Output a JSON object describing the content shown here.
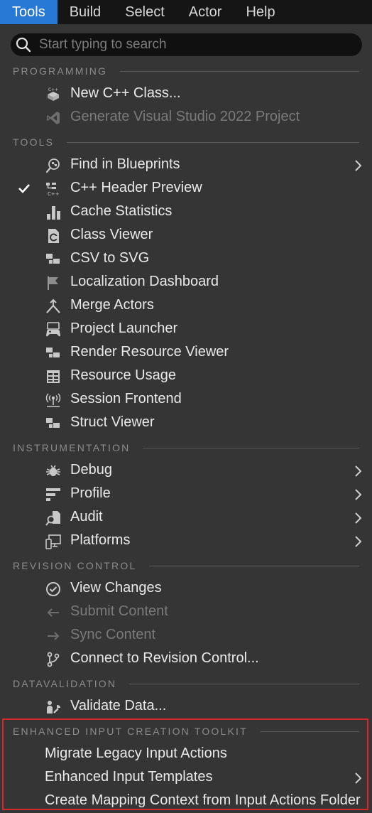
{
  "menubar": {
    "items": [
      "Tools",
      "Build",
      "Select",
      "Actor",
      "Help"
    ],
    "active": "Tools"
  },
  "search": {
    "placeholder": "Start typing to search",
    "icon": "search-icon"
  },
  "sections": {
    "programming": "PROGRAMMING",
    "tools": "TOOLS",
    "instrumentation": "INSTRUMENTATION",
    "revision_control": "REVISION CONTROL",
    "datavalidation": "DATAVALIDATION",
    "enhanced_input": "ENHANCED INPUT CREATION TOOLKIT"
  },
  "programming": [
    {
      "label": "New C++ Class...",
      "icon": "cpp-class-icon"
    },
    {
      "label": "Generate Visual Studio 2022 Project",
      "icon": "visual-studio-icon",
      "disabled": true
    }
  ],
  "tools": [
    {
      "label": "Find in Blueprints",
      "icon": "find-blueprints-icon",
      "submenu": true
    },
    {
      "label": "C++ Header Preview",
      "icon": "cpp-header-icon",
      "checked": true
    },
    {
      "label": "Cache Statistics",
      "icon": "bar-chart-icon"
    },
    {
      "label": "Class Viewer",
      "icon": "class-viewer-icon"
    },
    {
      "label": "CSV to SVG",
      "icon": "hierarchy-icon"
    },
    {
      "label": "Localization Dashboard",
      "icon": "flag-icon"
    },
    {
      "label": "Merge Actors",
      "icon": "merge-icon"
    },
    {
      "label": "Project Launcher",
      "icon": "gamepad-icon"
    },
    {
      "label": "Render Resource Viewer",
      "icon": "hierarchy-icon"
    },
    {
      "label": "Resource Usage",
      "icon": "table-icon"
    },
    {
      "label": "Session Frontend",
      "icon": "broadcast-icon"
    },
    {
      "label": "Struct Viewer",
      "icon": "hierarchy-icon"
    }
  ],
  "instrumentation": [
    {
      "label": "Debug",
      "icon": "bug-icon",
      "submenu": true
    },
    {
      "label": "Profile",
      "icon": "profile-bars-icon",
      "submenu": true
    },
    {
      "label": "Audit",
      "icon": "audit-icon",
      "submenu": true
    },
    {
      "label": "Platforms",
      "icon": "platforms-icon",
      "submenu": true
    }
  ],
  "revision_control": [
    {
      "label": "View Changes",
      "icon": "check-circle-icon"
    },
    {
      "label": "Submit Content",
      "icon": "arrow-left-icon",
      "disabled": true
    },
    {
      "label": "Sync Content",
      "icon": "arrow-right-icon",
      "disabled": true
    },
    {
      "label": "Connect to Revision Control...",
      "icon": "branch-icon"
    }
  ],
  "datavalidation": [
    {
      "label": "Validate Data...",
      "icon": "validate-icon"
    }
  ],
  "enhanced_input": [
    {
      "label": "Migrate Legacy Input Actions"
    },
    {
      "label": "Enhanced Input Templates",
      "submenu": true
    },
    {
      "label": "Create Mapping Context from Input Actions Folder"
    }
  ],
  "colors": {
    "background": "#353535",
    "menubar": "#151515",
    "active_tab": "#2878d6",
    "highlight_border": "#d62828"
  }
}
